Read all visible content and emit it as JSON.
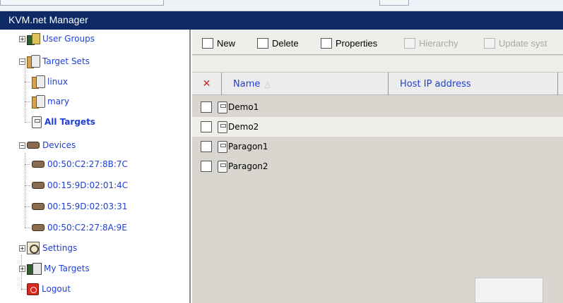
{
  "window": {
    "title": "KVM.net Manager"
  },
  "nav": {
    "items": [
      {
        "label": "User Groups",
        "icon": "user-groups-icon"
      },
      {
        "label": "Target Sets",
        "icon": "target-set-icon"
      },
      {
        "label": "linux",
        "icon": "target-set-icon"
      },
      {
        "label": "mary",
        "icon": "target-set-icon"
      },
      {
        "label": "All Targets",
        "icon": "target-icon"
      },
      {
        "label": "Devices",
        "icon": "device-icon"
      },
      {
        "label": "00:50:C2:27:8B:7C",
        "icon": "device-icon"
      },
      {
        "label": "00:15:9D:02:01:4C",
        "icon": "device-icon"
      },
      {
        "label": "00:15:9D:02:03:31",
        "icon": "device-icon"
      },
      {
        "label": "00:50:C2:27:8A:9E",
        "icon": "device-icon"
      },
      {
        "label": "Settings",
        "icon": "settings-icon"
      },
      {
        "label": "My Targets",
        "icon": "my-targets-icon"
      },
      {
        "label": "Logout",
        "icon": "logout-icon"
      }
    ]
  },
  "toolbar": {
    "new_label": "New",
    "delete_label": "Delete",
    "properties_label": "Properties",
    "hierarchy_label": "Hierarchy",
    "update_label": "Update syst"
  },
  "table": {
    "columns": [
      "Name",
      "Host IP address"
    ],
    "sort_indicator": "△",
    "delete_marker": "✕",
    "rows": [
      {
        "name": "Demo1",
        "host_ip": ""
      },
      {
        "name": "Demo2",
        "host_ip": ""
      },
      {
        "name": "Paragon1",
        "host_ip": ""
      },
      {
        "name": "Paragon2",
        "host_ip": ""
      }
    ]
  },
  "colors": {
    "title_bar": "#0d2a66",
    "link": "#1f3fd6",
    "pane_bg": "#d9d6d0"
  }
}
